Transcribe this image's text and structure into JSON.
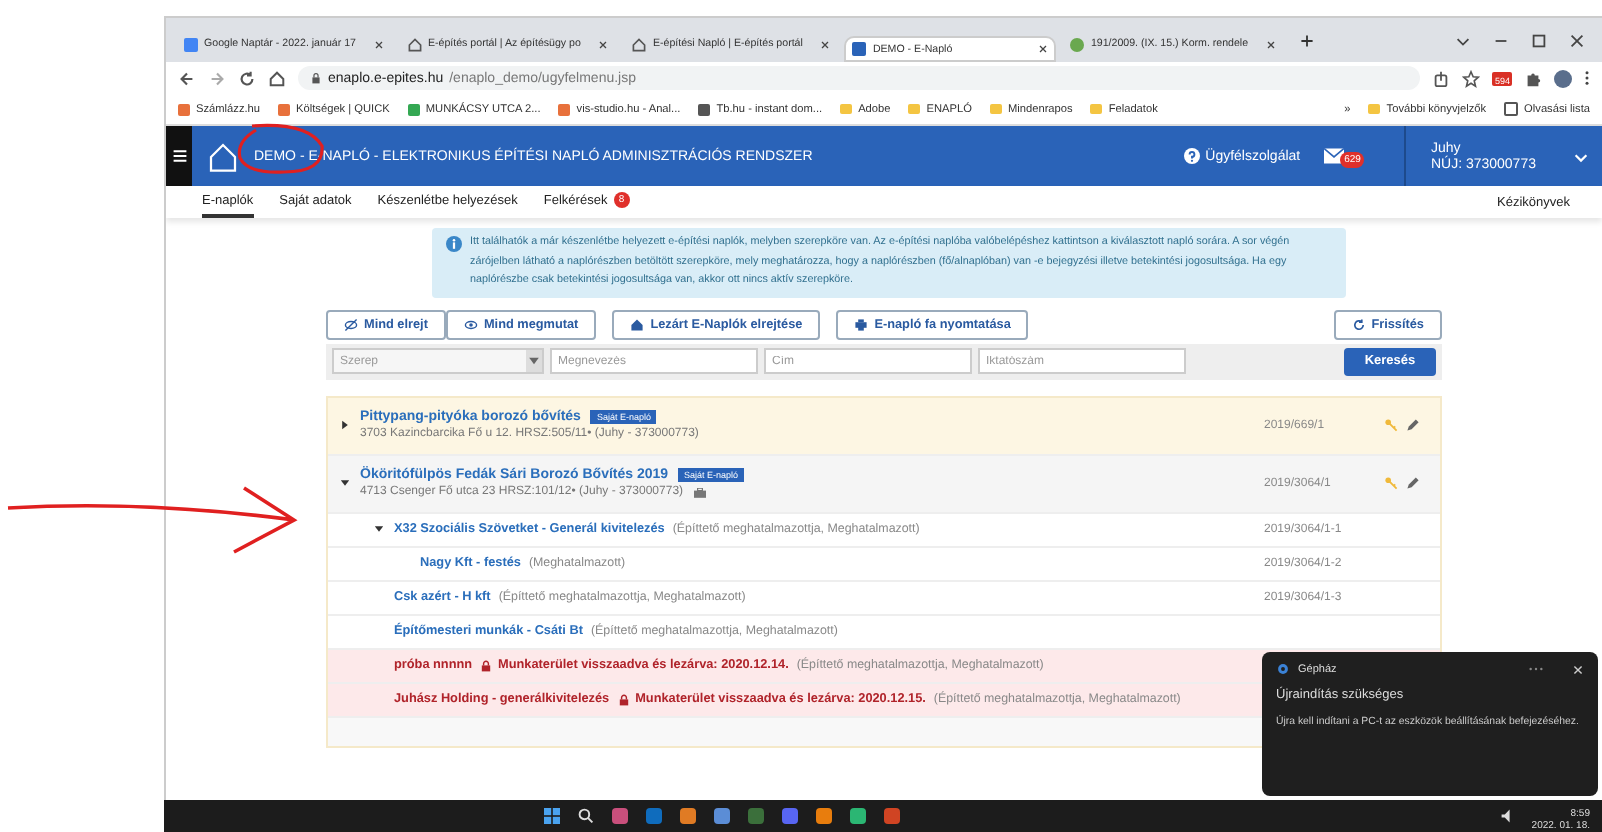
{
  "browser": {
    "tabs": [
      {
        "title": "Google Naptár - 2022. január 17",
        "selected": false
      },
      {
        "title": "E-építés portál | Az építésügy po",
        "selected": false
      },
      {
        "title": "E-építési Napló | E-építés portál",
        "selected": false
      },
      {
        "title": "DEMO - E-Napló",
        "selected": true
      },
      {
        "title": "191/2009. (IX. 15.) Korm. rendele",
        "selected": false
      }
    ],
    "url": {
      "host": "enaplo.e-epites.hu",
      "path": "/enaplo_demo/ugyfelmenu.jsp"
    },
    "extension_badge": "594",
    "bookmarks": [
      {
        "label": "Számlázz.hu",
        "kind": "site"
      },
      {
        "label": "Költségek | QUICK",
        "kind": "site"
      },
      {
        "label": "MUNKÁCSY UTCA 2...",
        "kind": "drive"
      },
      {
        "label": "vis-studio.hu - Anal...",
        "kind": "site"
      },
      {
        "label": "Tb.hu - instant dom...",
        "kind": "globe"
      },
      {
        "label": "Adobe",
        "kind": "folder"
      },
      {
        "label": "ENAPLÓ",
        "kind": "folder"
      },
      {
        "label": "Mindenrapos",
        "kind": "folder"
      },
      {
        "label": "Feladatok",
        "kind": "folder"
      }
    ],
    "bookmarks_more": "»",
    "other_bookmarks": "További könyvjelzők",
    "reading_list": "Olvasási lista"
  },
  "header": {
    "title": "DEMO - E-NAPLÓ - ELEKTRONIKUS ÉPÍTÉSI NAPLÓ ADMINISZTRÁCIÓS RENDSZER",
    "support": "Ügyfélszolgálat",
    "mail_count": "629",
    "user": "Juhy",
    "nuj": "NÚJ: 373000773"
  },
  "nav": {
    "items": [
      {
        "label": "E-naplók",
        "selected": true
      },
      {
        "label": "Saját adatok",
        "selected": false
      },
      {
        "label": "Készenlétbe helyezések",
        "selected": false
      },
      {
        "label": "Felkérések",
        "selected": false,
        "badge": "8"
      }
    ],
    "right": "Kézikönyvek"
  },
  "info": "Itt találhatók a már készenlétbe helyezett e-építési naplók, melyben szerepköre van. Az e-építési naplóba valóbelépéshez kattintson a kiválasztott napló sorára. A sor végén zárójelben látható a naplórészben betöltött szerepköre, mely meghatározza, hogy a naplórészben (fő/alnaplóban) van -e bejegyzési illetve betekintési jogosultsága. Ha egy naplórészbe csak betekintési jogosultsága van, akkor ott nincs aktív szerepköre.",
  "toolbar": {
    "hide_all": "Mind elrejt",
    "show_all": "Mind megmutat",
    "hide_closed": "Lezárt E-Naplók elrejtése",
    "print_tree": "E-napló fa nyomtatása",
    "refresh": "Frissítés"
  },
  "search": {
    "role_placeholder": "Szerep",
    "name_placeholder": "Megnevezés",
    "address_placeholder": "Cím",
    "number_placeholder": "Iktatószám",
    "button": "Keresés"
  },
  "diaries": [
    {
      "title": "Pittypang-pityóka borozó bővítés",
      "badge": "Saját E-napló",
      "address": "3703 Kazincbarcika Fő u 12. HRSZ:505/11• (Juhy - 373000773)",
      "case_icon": false,
      "number": "2019/669/1",
      "expanded": false
    },
    {
      "title": "Ököritófülpös Fedák Sári Borozó Bővítés 2019",
      "badge": "Saját E-napló",
      "address": "4713 Csenger Fő utca 23 HRSZ:101/12• (Juhy - 373000773)",
      "case_icon": true,
      "number": "2019/3064/1",
      "expanded": true,
      "children": [
        {
          "title": "X32 Szociális Szövetket - Generál kivitelezés",
          "roles": "(Építtető meghatalmazottja, Meghatalmazott)",
          "number": "2019/3064/1-1",
          "closed": false,
          "expanded": true,
          "children": [
            {
              "title": "Nagy Kft - festés",
              "roles": "(Meghatalmazott)",
              "number": "2019/3064/1-2",
              "closed": false
            }
          ]
        },
        {
          "title": "Csk azért - H kft",
          "roles": "(Építtető meghatalmazottja, Meghatalmazott)",
          "number": "2019/3064/1-3",
          "closed": false
        },
        {
          "title": "Építőmesteri munkák - Csáti Bt",
          "roles": "(Építtető meghatalmazottja, Meghatalmazott)",
          "closed": false
        },
        {
          "title": "próba nnnnn",
          "closed_note": "Munkaterület visszaadva és lezárva: 2020.12.14.",
          "roles": "(Építtető meghatalmazottja, Meghatalmazott)",
          "closed": true
        },
        {
          "title": "Juhász Holding - generálkivitelezés",
          "closed_note": "Munkaterület visszaadva és lezárva: 2020.12.15.",
          "roles": "(Építtető meghatalmazottja, Meghatalmazott)",
          "closed": true
        }
      ]
    }
  ],
  "toast": {
    "app": "Gépház",
    "title": "Újraindítás szükséges",
    "body": "Újra kell indítani a PC-t az eszközök beállításának befejezéséhez."
  },
  "taskbar": {
    "time": "8:59",
    "date": "2022. 01. 18."
  }
}
